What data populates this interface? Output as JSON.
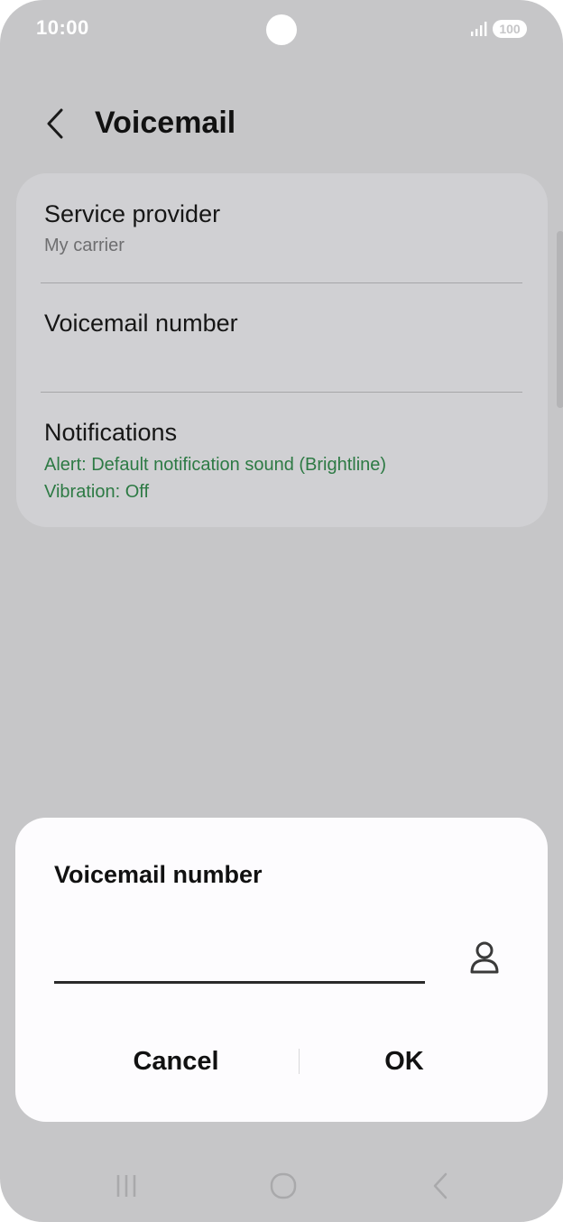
{
  "status_bar": {
    "time": "10:00",
    "battery": "100",
    "icons": [
      "signal-icon",
      "camera-cutout"
    ]
  },
  "header": {
    "title": "Voicemail",
    "back_icon": "chevron-left-icon"
  },
  "settings": {
    "service_provider": {
      "title": "Service provider",
      "subtitle": "My carrier"
    },
    "voicemail_number": {
      "title": "Voicemail number"
    },
    "notifications": {
      "title": "Notifications",
      "alert": "Alert: Default notification sound (Brightline)",
      "vibration": "Vibration: Off"
    }
  },
  "dialog": {
    "title": "Voicemail number",
    "input_value": "",
    "contact_icon": "contact-person-icon",
    "cancel_label": "Cancel",
    "ok_label": "OK"
  },
  "nav_bar": {
    "icons": [
      "recent-apps-icon",
      "home-icon",
      "back-icon"
    ]
  },
  "colors": {
    "background": "#c6c6c8",
    "card": "#d0d0d3",
    "dialog": "#fdfcfe",
    "accent_green": "#2d7a44"
  }
}
